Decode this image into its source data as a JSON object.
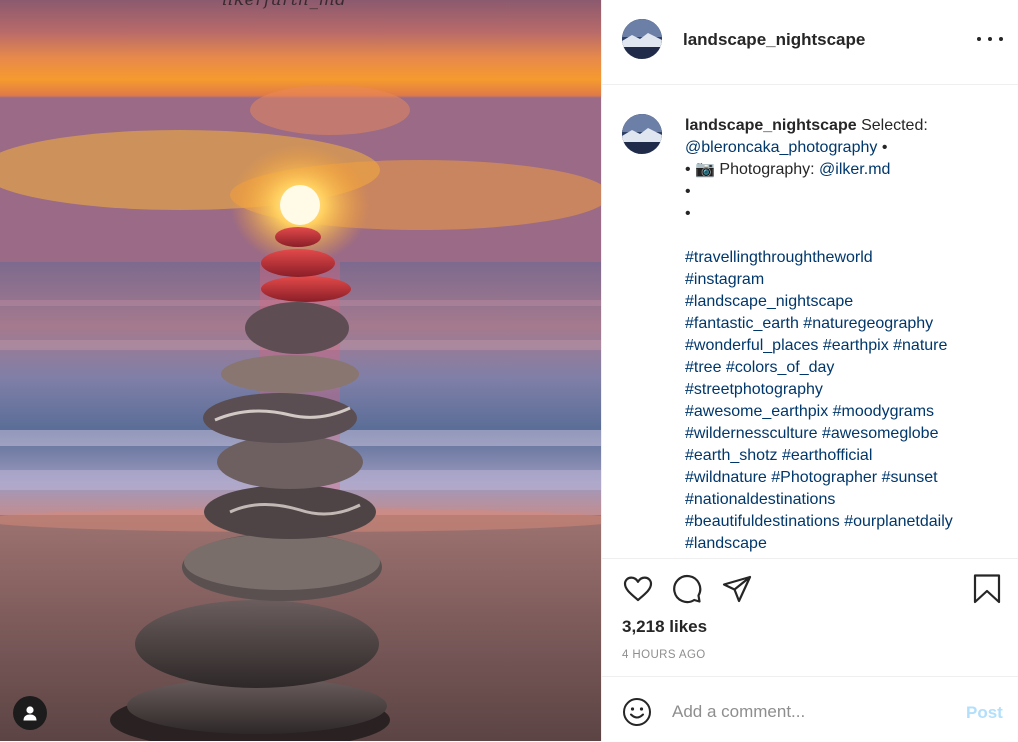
{
  "photo": {
    "watermark_text": "ilkerfurth_md",
    "user_tag_icon": "user-icon"
  },
  "header": {
    "username": "landscape_nightscape",
    "more_icon": "more-horizontal-icon"
  },
  "caption": {
    "username": "landscape_nightscape",
    "intro": " Selected:",
    "handle1": "@bleroncaka_photography",
    "sep1": " •",
    "bullet_prefix": "• ",
    "camera_emoji": "📷",
    "photo_label": " Photography: ",
    "handle2": "@ilker.md",
    "bullet2": "•",
    "bullet3": "•",
    "hashtag_lines": [
      "#travellingthroughtheworld",
      "#instagram",
      "#landscape_nightscape",
      "#fantastic_earth #naturegeography",
      "#wonderful_places #earthpix #nature",
      "#tree #colors_of_day",
      "#streetphotography",
      "#awesome_earthpix #moodygrams",
      "#wildernessculture #awesomeglobe",
      "#earth_shotz #earthofficial",
      "#wildnature #Photographer #sunset",
      "#nationaldestinations",
      "#beautifuldestinations #ourplanetdaily",
      "#landscape"
    ]
  },
  "actions": {
    "like_icon": "heart-icon",
    "comment_icon": "comment-icon",
    "share_icon": "send-icon",
    "save_icon": "bookmark-icon",
    "likes": "3,218 likes",
    "timestamp": "4 HOURS AGO"
  },
  "comment": {
    "emoji_icon": "smiley-icon",
    "placeholder": "Add a comment...",
    "post_label": "Post"
  },
  "colors": {
    "link": "#00376b",
    "muted": "#8e8e8e",
    "post_disabled": "#b2dffc",
    "text": "#262626",
    "border": "#efefef"
  }
}
